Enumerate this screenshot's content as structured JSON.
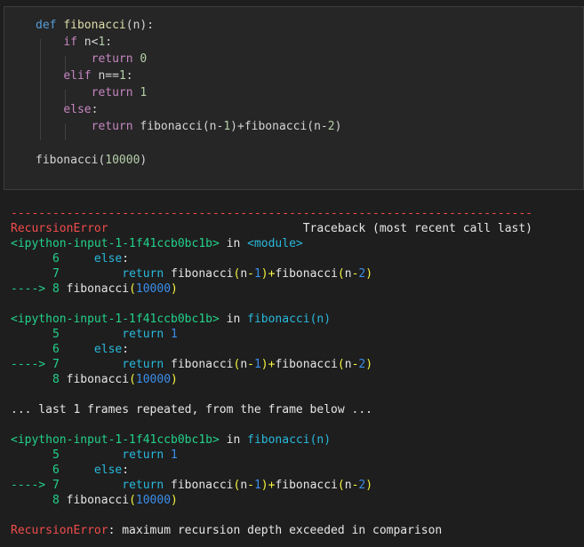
{
  "code_cell": {
    "lines": [
      [
        {
          "t": "def",
          "c": "kw"
        },
        {
          "t": " "
        },
        {
          "t": "fibonacci",
          "c": "fn"
        },
        {
          "t": "(n):",
          "c": "plain"
        }
      ],
      [
        {
          "t": "    "
        },
        {
          "t": "if",
          "c": "ctrl"
        },
        {
          "t": " n<",
          "c": "plain"
        },
        {
          "t": "1",
          "c": "num"
        },
        {
          "t": ":",
          "c": "plain"
        }
      ],
      [
        {
          "t": "        "
        },
        {
          "t": "return",
          "c": "ctrl"
        },
        {
          "t": " "
        },
        {
          "t": "0",
          "c": "num"
        }
      ],
      [
        {
          "t": "    "
        },
        {
          "t": "elif",
          "c": "ctrl"
        },
        {
          "t": " n==",
          "c": "plain"
        },
        {
          "t": "1",
          "c": "num"
        },
        {
          "t": ":",
          "c": "plain"
        }
      ],
      [
        {
          "t": "        "
        },
        {
          "t": "return",
          "c": "ctrl"
        },
        {
          "t": " "
        },
        {
          "t": "1",
          "c": "num"
        }
      ],
      [
        {
          "t": "    "
        },
        {
          "t": "else",
          "c": "ctrl"
        },
        {
          "t": ":",
          "c": "plain"
        }
      ],
      [
        {
          "t": "        "
        },
        {
          "t": "return",
          "c": "ctrl"
        },
        {
          "t": " fibonacci(n-",
          "c": "plain"
        },
        {
          "t": "1",
          "c": "num"
        },
        {
          "t": ")+fibonacci(n-",
          "c": "plain"
        },
        {
          "t": "2",
          "c": "num"
        },
        {
          "t": ")",
          "c": "plain"
        }
      ],
      [],
      [
        {
          "t": "fibonacci(",
          "c": "plain"
        },
        {
          "t": "10000",
          "c": "num"
        },
        {
          "t": ")",
          "c": "plain"
        }
      ]
    ]
  },
  "output": {
    "lines": [
      [
        {
          "t": "---------------------------------------------------------------------------",
          "c": "red"
        }
      ],
      [
        {
          "t": "RecursionError",
          "c": "red"
        },
        {
          "t": "                            Traceback (most recent call last)",
          "c": "white"
        }
      ],
      [
        {
          "t": "<ipython-input-1-1f41ccb0bc1b>",
          "c": "green"
        },
        {
          "t": " in ",
          "c": "white"
        },
        {
          "t": "<module>",
          "c": "cyan"
        }
      ],
      [
        {
          "t": "      6 ",
          "c": "green"
        },
        {
          "t": "    else",
          "c": "cyan"
        },
        {
          "t": ":",
          "c": "white"
        }
      ],
      [
        {
          "t": "      7 ",
          "c": "green"
        },
        {
          "t": "        return",
          "c": "cyan"
        },
        {
          "t": " fibonacci",
          "c": "white"
        },
        {
          "t": "(",
          "c": "yellow"
        },
        {
          "t": "n",
          "c": "white"
        },
        {
          "t": "-",
          "c": "yellow"
        },
        {
          "t": "1",
          "c": "blue"
        },
        {
          "t": ")+",
          "c": "yellow"
        },
        {
          "t": "fibonacci",
          "c": "white"
        },
        {
          "t": "(",
          "c": "yellow"
        },
        {
          "t": "n",
          "c": "white"
        },
        {
          "t": "-",
          "c": "yellow"
        },
        {
          "t": "2",
          "c": "blue"
        },
        {
          "t": ")",
          "c": "yellow"
        }
      ],
      [
        {
          "t": "----> 8 ",
          "c": "green"
        },
        {
          "t": "fibonacci",
          "c": "white"
        },
        {
          "t": "(",
          "c": "yellow"
        },
        {
          "t": "10000",
          "c": "blue"
        },
        {
          "t": ")",
          "c": "yellow"
        }
      ],
      [],
      [
        {
          "t": "<ipython-input-1-1f41ccb0bc1b>",
          "c": "green"
        },
        {
          "t": " in ",
          "c": "white"
        },
        {
          "t": "fibonacci",
          "c": "cyan"
        },
        {
          "t": "(n)",
          "c": "cyan"
        }
      ],
      [
        {
          "t": "      5 ",
          "c": "green"
        },
        {
          "t": "        return",
          "c": "cyan"
        },
        {
          "t": " 1",
          "c": "blue"
        }
      ],
      [
        {
          "t": "      6 ",
          "c": "green"
        },
        {
          "t": "    else",
          "c": "cyan"
        },
        {
          "t": ":",
          "c": "white"
        }
      ],
      [
        {
          "t": "----> 7 ",
          "c": "green"
        },
        {
          "t": "        return",
          "c": "cyan"
        },
        {
          "t": " fibonacci",
          "c": "white"
        },
        {
          "t": "(",
          "c": "yellow"
        },
        {
          "t": "n",
          "c": "white"
        },
        {
          "t": "-",
          "c": "yellow"
        },
        {
          "t": "1",
          "c": "blue"
        },
        {
          "t": ")+",
          "c": "yellow"
        },
        {
          "t": "fibonacci",
          "c": "white"
        },
        {
          "t": "(",
          "c": "yellow"
        },
        {
          "t": "n",
          "c": "white"
        },
        {
          "t": "-",
          "c": "yellow"
        },
        {
          "t": "2",
          "c": "blue"
        },
        {
          "t": ")",
          "c": "yellow"
        }
      ],
      [
        {
          "t": "      8 ",
          "c": "green"
        },
        {
          "t": "fibonacci",
          "c": "white"
        },
        {
          "t": "(",
          "c": "yellow"
        },
        {
          "t": "10000",
          "c": "blue"
        },
        {
          "t": ")",
          "c": "yellow"
        }
      ],
      [],
      [
        {
          "t": "... last 1 frames repeated, from the frame below ...",
          "c": "white"
        }
      ],
      [],
      [
        {
          "t": "<ipython-input-1-1f41ccb0bc1b>",
          "c": "green"
        },
        {
          "t": " in ",
          "c": "white"
        },
        {
          "t": "fibonacci",
          "c": "cyan"
        },
        {
          "t": "(n)",
          "c": "cyan"
        }
      ],
      [
        {
          "t": "      5 ",
          "c": "green"
        },
        {
          "t": "        return",
          "c": "cyan"
        },
        {
          "t": " 1",
          "c": "blue"
        }
      ],
      [
        {
          "t": "      6 ",
          "c": "green"
        },
        {
          "t": "    else",
          "c": "cyan"
        },
        {
          "t": ":",
          "c": "white"
        }
      ],
      [
        {
          "t": "----> 7 ",
          "c": "green"
        },
        {
          "t": "        return",
          "c": "cyan"
        },
        {
          "t": " fibonacci",
          "c": "white"
        },
        {
          "t": "(",
          "c": "yellow"
        },
        {
          "t": "n",
          "c": "white"
        },
        {
          "t": "-",
          "c": "yellow"
        },
        {
          "t": "1",
          "c": "blue"
        },
        {
          "t": ")+",
          "c": "yellow"
        },
        {
          "t": "fibonacci",
          "c": "white"
        },
        {
          "t": "(",
          "c": "yellow"
        },
        {
          "t": "n",
          "c": "white"
        },
        {
          "t": "-",
          "c": "yellow"
        },
        {
          "t": "2",
          "c": "blue"
        },
        {
          "t": ")",
          "c": "yellow"
        }
      ],
      [
        {
          "t": "      8 ",
          "c": "green"
        },
        {
          "t": "fibonacci",
          "c": "white"
        },
        {
          "t": "(",
          "c": "yellow"
        },
        {
          "t": "10000",
          "c": "blue"
        },
        {
          "t": ")",
          "c": "yellow"
        }
      ],
      [],
      [
        {
          "t": "RecursionError",
          "c": "red"
        },
        {
          "t": ": maximum recursion depth exceeded in comparison",
          "c": "white"
        }
      ]
    ]
  }
}
